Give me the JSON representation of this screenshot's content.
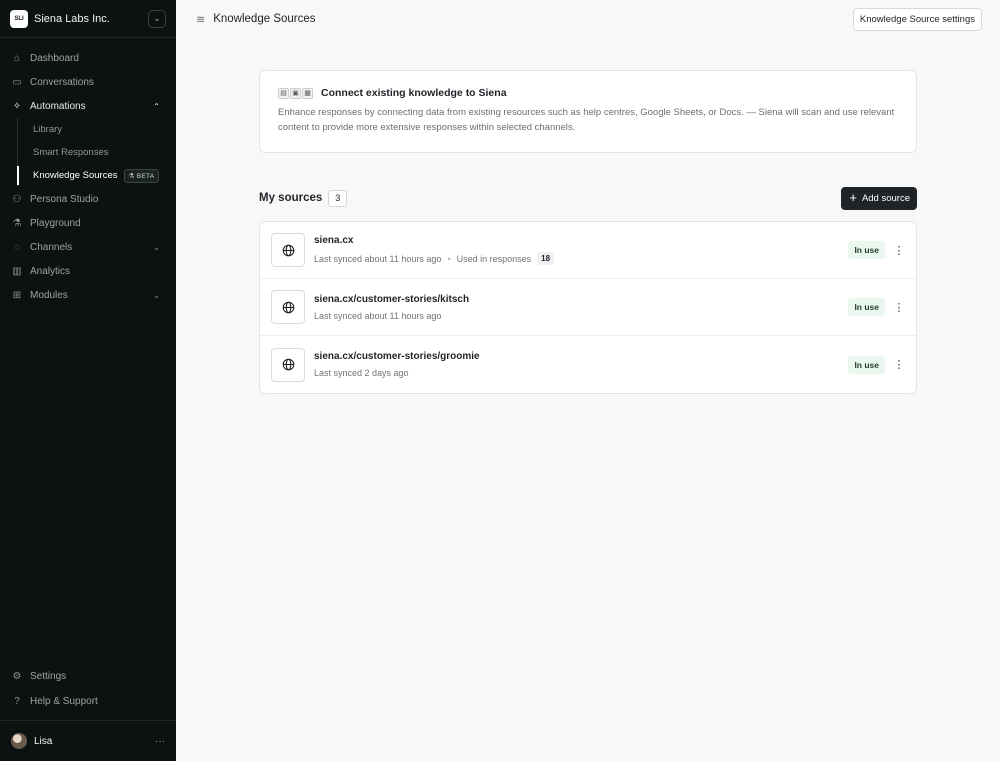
{
  "workspace": {
    "initials": "SLI",
    "name": "Siena Labs Inc."
  },
  "nav": {
    "dashboard": "Dashboard",
    "conversations": "Conversations",
    "automations": "Automations",
    "automations_sub": [
      "Library",
      "Smart Responses",
      "Knowledge Sources"
    ],
    "beta_badge": "BETA",
    "persona_studio": "Persona Studio",
    "playground": "Playground",
    "channels": "Channels",
    "analytics": "Analytics",
    "modules": "Modules",
    "settings": "Settings",
    "help": "Help & Support"
  },
  "user": {
    "name": "Lisa",
    "more": "···"
  },
  "topbar": {
    "title": "Knowledge Sources",
    "settings_button": "Knowledge Source settings"
  },
  "banner": {
    "title": "Connect existing knowledge to Siena",
    "text": "Enhance responses by connecting data from existing resources such as help centres, Google Sheets, or Docs. — Siena will scan and use relevant content to provide more extensive responses within selected channels."
  },
  "sources": {
    "title": "My sources",
    "count": "3",
    "add_button": "Add source",
    "items": [
      {
        "name": "siena.cx",
        "synced": "Last synced about 11 hours ago",
        "used_label": "Used in responses",
        "used_count": "18",
        "status": "In use"
      },
      {
        "name": "siena.cx/customer-stories/kitsch",
        "synced": "Last synced about 11 hours ago",
        "status": "In use"
      },
      {
        "name": "siena.cx/customer-stories/groomie",
        "synced": "Last synced 2 days ago",
        "status": "In use"
      }
    ]
  }
}
